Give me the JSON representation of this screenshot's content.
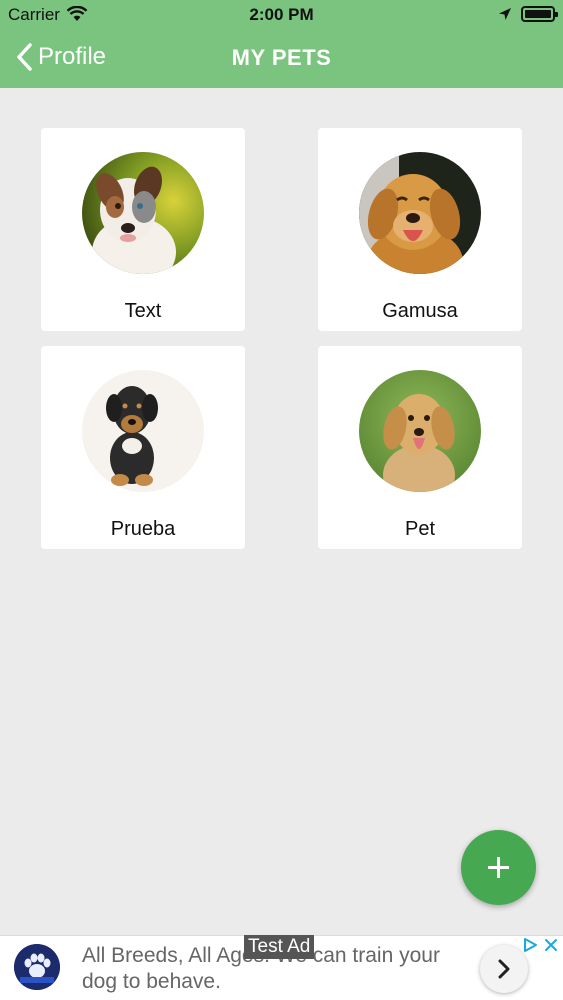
{
  "status_bar": {
    "carrier": "Carrier",
    "time": "2:00 PM",
    "icons": [
      "wifi-icon",
      "location-arrow-icon",
      "battery-icon"
    ]
  },
  "nav": {
    "back_label": "Profile",
    "title": "MY PETS",
    "icons": [
      "chevron-left-icon"
    ]
  },
  "pets": [
    {
      "name": "Text",
      "photo": "australian-shepherd-puppy"
    },
    {
      "name": "Gamusa",
      "photo": "golden-retriever"
    },
    {
      "name": "Prueba",
      "photo": "black-tan-puppy"
    },
    {
      "name": "Pet",
      "photo": "golden-retriever-on-grass"
    }
  ],
  "fab": {
    "icon": "plus-icon"
  },
  "ad": {
    "badge": "Test Ad",
    "text": "All Breeds, All Ages. We can train your dog to behave.",
    "logo": "paw-logo",
    "icons": [
      "ad-choices-icon",
      "close-icon",
      "chevron-right-icon"
    ]
  },
  "colors": {
    "nav_green": "#7ac47f",
    "fab_green": "#47a852",
    "background": "#ebebeb",
    "card": "#ffffff"
  }
}
